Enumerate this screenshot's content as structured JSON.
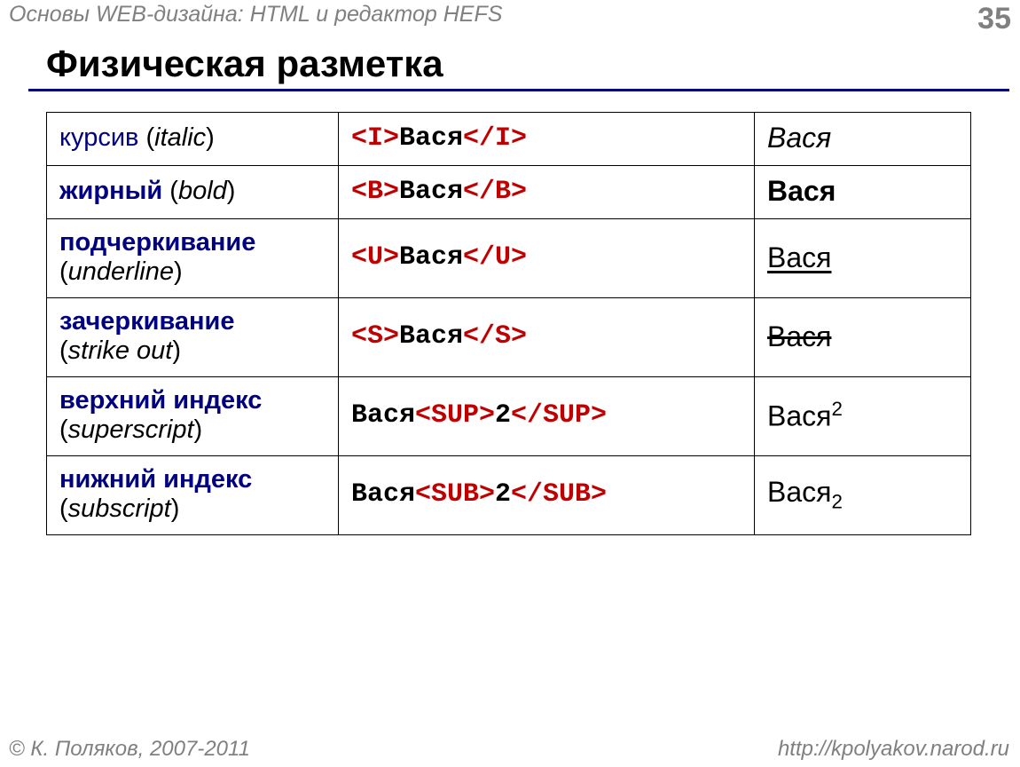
{
  "header": {
    "subject": "Основы WEB-дизайна: HTML и редактор HEFS",
    "page_number": "35"
  },
  "title": "Физическая разметка",
  "rows": [
    {
      "label_ru": "курсив",
      "label_en": "italic",
      "tag_open": "<I>",
      "tag_close": "</I>",
      "pre_text": "",
      "inner_text": "Вася",
      "result_text": "Вася",
      "result_style": "italic",
      "tall": false,
      "label_bold": false
    },
    {
      "label_ru": "жирный",
      "label_en": "bold",
      "tag_open": "<B>",
      "tag_close": "</B>",
      "pre_text": "",
      "inner_text": "Вася",
      "result_text": "Вася",
      "result_style": "bold",
      "tall": false,
      "label_bold": true
    },
    {
      "label_ru": "подчеркивание",
      "label_en": "underline",
      "tag_open": "<U>",
      "tag_close": "</U>",
      "pre_text": "",
      "inner_text": "Вася",
      "result_text": "Вася",
      "result_style": "underline",
      "tall": true,
      "label_bold": true
    },
    {
      "label_ru": "зачеркивание",
      "label_en": "strike out",
      "tag_open": "<S>",
      "tag_close": "</S>",
      "pre_text": "",
      "inner_text": "Вася",
      "result_text": "Вася",
      "result_style": "strike",
      "tall": true,
      "label_bold": true
    },
    {
      "label_ru": "верхний индекс",
      "label_en": "superscript",
      "tag_open": "<SUP>",
      "tag_close": "</SUP>",
      "pre_text": "Вася",
      "inner_text": "2",
      "result_text": "Вася",
      "result_suffix": "2",
      "result_style": "sup",
      "tall": true,
      "label_bold": true
    },
    {
      "label_ru": "нижний индекс",
      "label_en": "subscript",
      "tag_open": "<SUB>",
      "tag_close": "</SUB>",
      "pre_text": "Вася",
      "inner_text": "2",
      "result_text": "Вася",
      "result_suffix": "2",
      "result_style": "sub",
      "tall": true,
      "label_bold": true
    }
  ],
  "footer": {
    "copyright": "© К. Поляков, 2007-2011",
    "url": "http://kpolyakov.narod.ru"
  }
}
